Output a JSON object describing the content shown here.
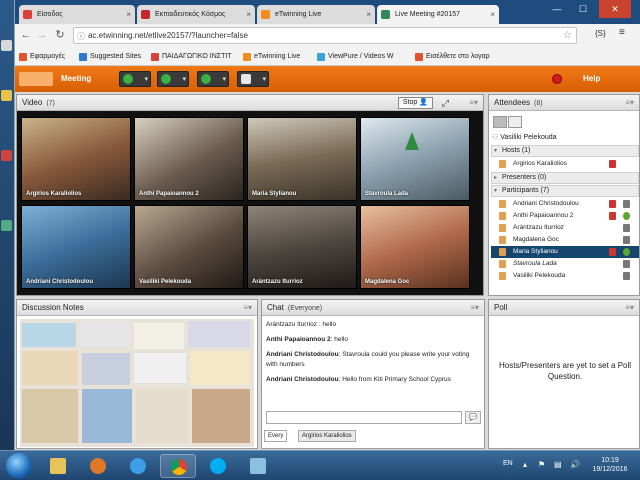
{
  "browser": {
    "tabs": [
      {
        "label": "Είσοδος",
        "icon": "gmail-icon",
        "color": "#d8423a"
      },
      {
        "label": "Εκπαιδευτικός Κόσμος",
        "icon": "shield-icon",
        "color": "#c0282e"
      },
      {
        "label": "eTwinning Live",
        "icon": "etwinning-icon",
        "color": "#f28c1c"
      },
      {
        "label": "Live Meeting #20157",
        "icon": "connect-icon",
        "color": "#2e8b57"
      }
    ],
    "url": "ac.etwinning.net/etlive20157/?launcher=false",
    "window_controls": {
      "minimize": "—",
      "maximize": "☐",
      "close": "✕"
    },
    "extensions": [
      "{S}",
      "≡"
    ],
    "bookmarks": [
      {
        "label": "Εφαρμογές",
        "color": "#e0542a"
      },
      {
        "label": "Suggested Sites",
        "color": "#2d7ccf"
      },
      {
        "label": "ΠΑΙΔΑΓΩΓΙΚΟ ΙΝΣΤΙΤ",
        "color": "#d8423a"
      },
      {
        "label": "eTwinning Live",
        "color": "#f28c1c"
      },
      {
        "label": "ViewPure / Videos W",
        "color": "#38a3d8"
      },
      {
        "label": "Εισέλθετε στο λογαρ",
        "color": "#e0542a"
      }
    ]
  },
  "app": {
    "menu_title": "Meeting",
    "help_label": "Help",
    "accent": "#e36a0c"
  },
  "video_pod": {
    "title": "Video",
    "count": "(7)",
    "stop_label": "Stop",
    "tiles": [
      {
        "name": "Argirios Karaliolios",
        "bg": "#8a5a3c"
      },
      {
        "name": "Anthi Papaioannou 2",
        "bg": "#6b5b4e"
      },
      {
        "name": "Maria Stylianou",
        "bg": "#7a6a55"
      },
      {
        "name": "Stavroula Lada",
        "bg": "#8aa0ae"
      },
      {
        "name": "Andriani Christodoulou",
        "bg": "#3b6e9a"
      },
      {
        "name": "Vasiliki Pelekouda",
        "bg": "#5a4a3e"
      },
      {
        "name": "Arántzazu Iturrioz",
        "bg": "#4e4740"
      },
      {
        "name": "Magdalena Goc",
        "bg": "#b06a4a"
      }
    ]
  },
  "attendees_pod": {
    "title": "Attendees",
    "count": "(8)",
    "current_user": "Vasiliki Pelekouda",
    "hosts_label": "Hosts (1)",
    "hosts": [
      "Argirios Karaliolios"
    ],
    "presenters_label": "Presenters (0)",
    "participants_label": "Participants (7)",
    "participants": [
      "Andriani Christodoulou",
      "Anthi Papaioannou 2",
      "Arántzazu Iturrioz",
      "Magdalena Goc",
      "Maria Stylianou",
      "Stavroula Lada",
      "Vasiliki Pelekouda"
    ],
    "selected": "Maria Stylianou"
  },
  "notes_pod": {
    "title": "Discussion Notes"
  },
  "chat_pod": {
    "title": "Chat",
    "scope": "(Everyone)",
    "messages": [
      {
        "author": "Arántzazu Iturrioz",
        "text": ": hello"
      },
      {
        "author": "Anthi Papaioannou 2",
        "text": ": hello"
      },
      {
        "author": "Andriani Christodoulou",
        "text": ": Stavroula could you please write your voting with numbers"
      },
      {
        "author": "Andriani Christodoulou",
        "text": ": Hello from Kiti Primary School Cyprus"
      }
    ],
    "tabs": [
      "Every",
      "Argirios Karaliolios"
    ]
  },
  "poll_pod": {
    "title": "Poll",
    "message": "Hosts/Presenters are yet to set a Poll Question."
  },
  "taskbar": {
    "language": "EN",
    "time": "10:19",
    "date": "19/12/2016"
  }
}
